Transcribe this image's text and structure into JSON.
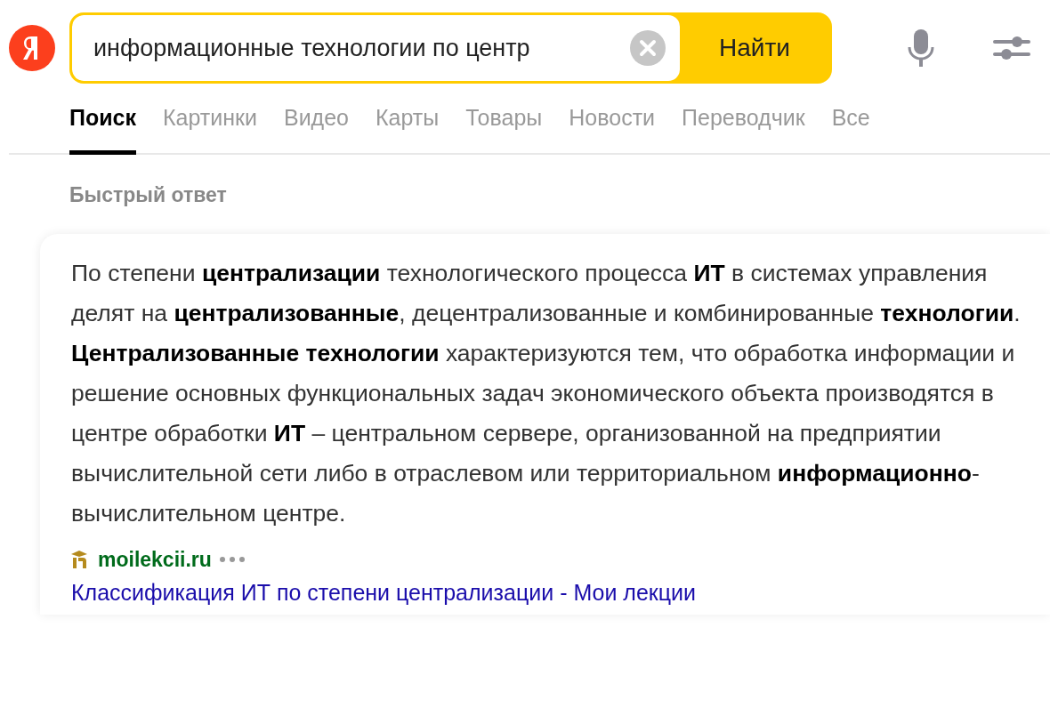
{
  "search": {
    "value": "информационные технологии по центр",
    "button": "Найти"
  },
  "tabs": [
    {
      "label": "Поиск",
      "selected": true
    },
    {
      "label": "Картинки",
      "selected": false
    },
    {
      "label": "Видео",
      "selected": false
    },
    {
      "label": "Карты",
      "selected": false
    },
    {
      "label": "Товары",
      "selected": false
    },
    {
      "label": "Новости",
      "selected": false
    },
    {
      "label": "Переводчик",
      "selected": false
    },
    {
      "label": "Все",
      "selected": false
    }
  ],
  "quick_answer": {
    "heading": "Быстрый ответ",
    "text": "По степени **централизации** технологического процесса **ИТ** в системах управления делят на **централизованные**, децентрализованные и комбинированные **технологии**. **Централизованные технологии** характеризуются тем, что обработка информации и решение основных функциональных задач экономического объекта производятся в центре обработки **ИТ** – центральном сервере, организованной на предприятии вычислительной сети либо в отраслевом или территориальном **информационно**-вычислительном центре.",
    "source": "moilekcii.ru",
    "link": "Классификация ИТ по степени централизации - Мои лекции"
  }
}
